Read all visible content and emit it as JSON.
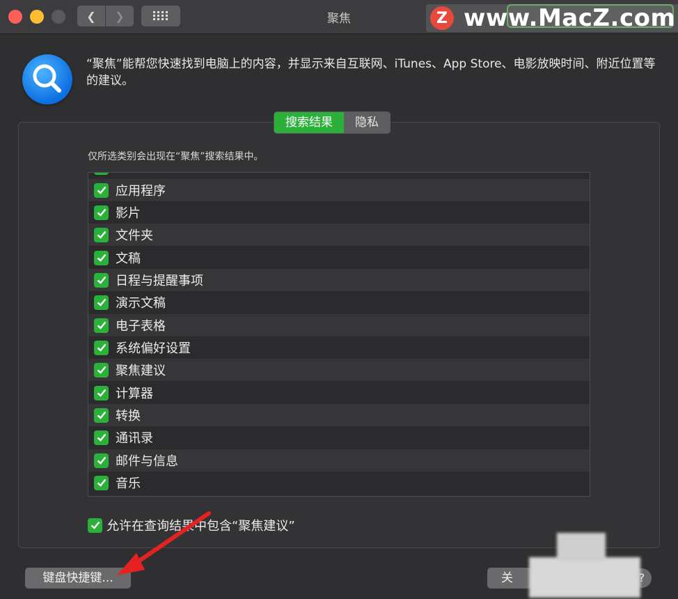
{
  "window": {
    "title": "聚焦"
  },
  "watermark": {
    "logo_letter": "Z",
    "text": "www.MacZ.com"
  },
  "intro": "“聚焦”能帮您快速找到电脑上的内容，并显示来自互联网、iTunes、App Store、电影放映时间、附近位置等的建议。",
  "tabs": [
    {
      "label": "搜索结果",
      "active": true
    },
    {
      "label": "隐私",
      "active": false
    }
  ],
  "hint": "仅所选类别会出现在“聚焦”搜索结果中。",
  "categories": [
    {
      "label": "应用程序",
      "checked": true
    },
    {
      "label": "影片",
      "checked": true
    },
    {
      "label": "文件夹",
      "checked": true
    },
    {
      "label": "文稿",
      "checked": true
    },
    {
      "label": "日程与提醒事项",
      "checked": true
    },
    {
      "label": "演示文稿",
      "checked": true
    },
    {
      "label": "电子表格",
      "checked": true
    },
    {
      "label": "系统偏好设置",
      "checked": true
    },
    {
      "label": "聚焦建议",
      "checked": true
    },
    {
      "label": "计算器",
      "checked": true
    },
    {
      "label": "转换",
      "checked": true
    },
    {
      "label": "通讯录",
      "checked": true
    },
    {
      "label": "邮件与信息",
      "checked": true
    },
    {
      "label": "音乐",
      "checked": true
    }
  ],
  "allow_suggestions": {
    "label": "允许在查询结果中包含“聚焦建议”",
    "checked": true
  },
  "buttons": {
    "shortcuts": "键盘快捷键...",
    "close_partial": "关",
    "help": "?"
  },
  "colors": {
    "accent": "#2bb13a",
    "arrow": "#e52222"
  }
}
